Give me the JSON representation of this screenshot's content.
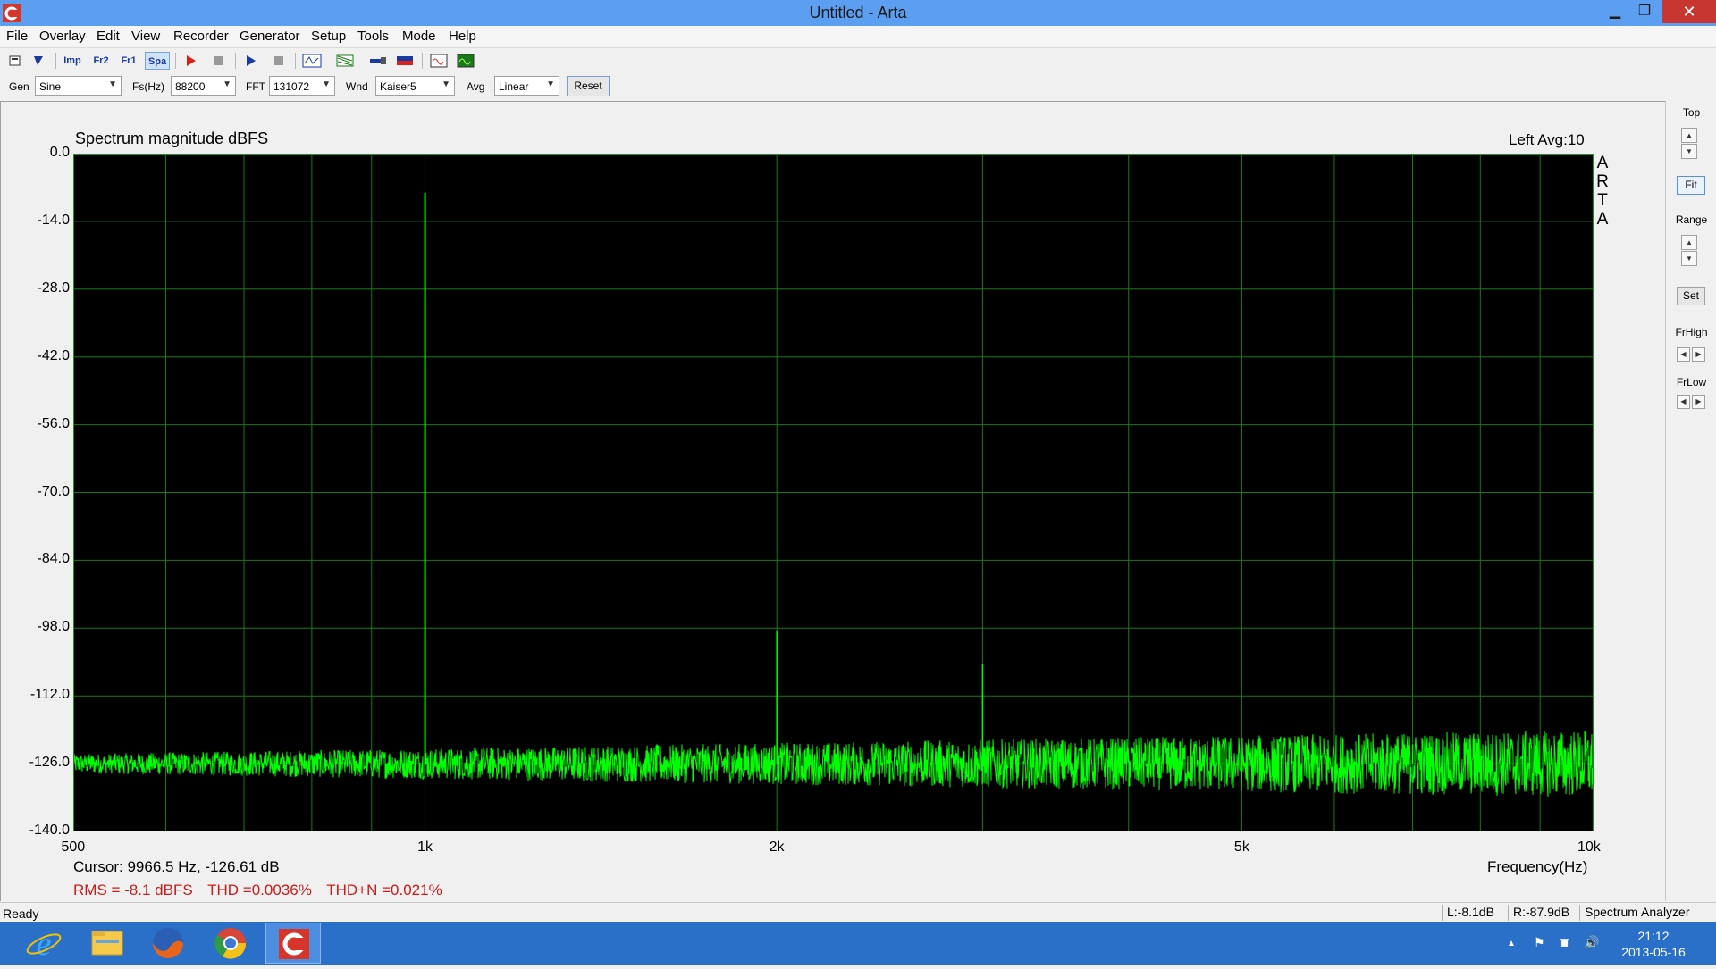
{
  "window": {
    "title": "Untitled - Arta",
    "minimize": "▁",
    "maximize": "❐",
    "close": "✕"
  },
  "menu": [
    "File",
    "Overlay",
    "Edit",
    "View",
    "Recorder",
    "Generator",
    "Setup",
    "Tools",
    "Mode",
    "Help"
  ],
  "toolbar": {
    "mode_buttons": [
      {
        "name": "impulse-mode-button",
        "label": "Imp"
      },
      {
        "name": "fr2-mode-button",
        "label": "Fr2"
      },
      {
        "name": "fr1-mode-button",
        "label": "Fr1"
      },
      {
        "name": "spa-mode-button",
        "label": "Spa",
        "active": true
      }
    ]
  },
  "settings": {
    "gen_label": "Gen",
    "gen_value": "Sine",
    "fs_label": "Fs(Hz)",
    "fs_value": "88200",
    "fft_label": "FFT",
    "fft_value": "131072",
    "wnd_label": "Wnd",
    "wnd_value": "Kaiser5",
    "avg_label": "Avg",
    "avg_value": "Linear",
    "reset_label": "Reset"
  },
  "chart": {
    "title": "Spectrum magnitude dBFS",
    "channel_avg": "Left  Avg:10",
    "brand_letters": [
      "A",
      "R",
      "T",
      "A"
    ],
    "x_axis_title": "Frequency(Hz)",
    "cursor_text": "Cursor:  9966.5 Hz, -126.61 dB",
    "measurements": [
      "RMS =   -8.1 dBFS",
      "THD =0.0036%",
      "THD+N =0.021%"
    ]
  },
  "chart_data": {
    "type": "line",
    "x_scale": "log",
    "xlim": [
      500,
      10000
    ],
    "ylim": [
      -140,
      0
    ],
    "x_ticks": [
      {
        "value": 500,
        "label": "500"
      },
      {
        "value": 1000,
        "label": "1k"
      },
      {
        "value": 2000,
        "label": "2k"
      },
      {
        "value": 5000,
        "label": "5k"
      },
      {
        "value": 10000,
        "label": "10k"
      }
    ],
    "y_ticks": [
      0,
      -14,
      -28,
      -42,
      -56,
      -70,
      -84,
      -98,
      -112,
      -126,
      -140
    ],
    "y_tick_labels": [
      "0.0",
      "-14.0",
      "-28.0",
      "-42.0",
      "-56.0",
      "-70.0",
      "-84.0",
      "-98.0",
      "-112.0",
      "-126.0",
      "-140.0"
    ],
    "grid": true,
    "line_color": "#00ff00",
    "background": "#000000",
    "noise_floor_db": -126,
    "peaks": [
      {
        "freq": 1000,
        "db": -8.1
      },
      {
        "freq": 2000,
        "db": -98.5
      },
      {
        "freq": 3000,
        "db": -105.5
      },
      {
        "freq": 7000,
        "db": -122
      }
    ]
  },
  "right_panel": {
    "top_label": "Top",
    "fit_label": "Fit",
    "range_label": "Range",
    "set_label": "Set",
    "frhigh_label": "FrHigh",
    "frlow_label": "FrLow"
  },
  "status": {
    "ready": "Ready",
    "left_level": "L:-8.1dB",
    "right_level": "R:-87.9dB",
    "mode": "Spectrum Analyzer"
  },
  "taskbar": {
    "apps": [
      "internet-explorer",
      "file-explorer",
      "firefox",
      "chrome",
      "arta"
    ],
    "time": "21:12",
    "date": "2013-05-16"
  },
  "colors": {
    "title_bar": "#5c9ff0",
    "taskbar": "#2a6fc8",
    "trace": "#00ff00",
    "grid": "#1a7a1a",
    "measurement_text": "#cc1a1a"
  }
}
